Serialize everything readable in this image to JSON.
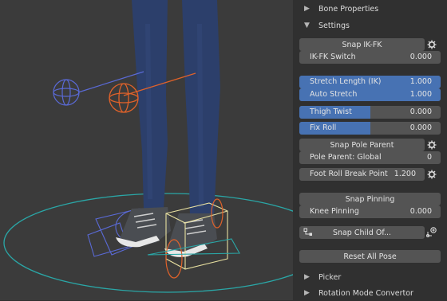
{
  "panel": {
    "bone_properties": "Bone Properties",
    "settings": "Settings",
    "snap_ikfk": "Snap IK-FK",
    "ikfk_switch": {
      "label": "IK-FK Switch",
      "value": "0.000"
    },
    "stretch_length": {
      "label": "Stretch Length (IK)",
      "value": "1.000",
      "fill": 1.0
    },
    "auto_stretch": {
      "label": "Auto Stretch",
      "value": "1.000",
      "fill": 1.0
    },
    "thigh_twist": {
      "label": "Thigh Twist",
      "value": "0.000",
      "fill": 0.5
    },
    "fix_roll": {
      "label": "Fix Roll",
      "value": "0.000",
      "fill": 0.5
    },
    "snap_pole_parent": "Snap Pole Parent",
    "pole_parent": {
      "label": "Pole Parent: Global",
      "value": "0"
    },
    "foot_roll": {
      "label": "Foot Roll Break Point",
      "value": "1.200"
    },
    "snap_pinning": "Snap Pinning",
    "knee_pinning": {
      "label": "Knee Pinning",
      "value": "0.000"
    },
    "snap_child_of": "Snap Child Of...",
    "reset_all_pose": "Reset All Pose",
    "picker": "Picker",
    "rotation_mode_convertor": "Rotation Mode Convertor"
  },
  "icons": {
    "gear": "gear-icon",
    "chevron_right": "chevron-right-icon",
    "chevron_down": "chevron-down-icon",
    "constraint_left": "constraint-icon",
    "add_constraint_right": "add-constraint-icon"
  },
  "colors": {
    "viewport_bg": "#3b3b3b",
    "panel_bg": "#303030",
    "field_bg": "#545454",
    "accent_blue": "#4772b3",
    "teal_circle": "#2aa7a7",
    "orange_bone": "#e0622a",
    "blue_bone": "#5a6ad6",
    "jeans": "#2c3f6b"
  }
}
